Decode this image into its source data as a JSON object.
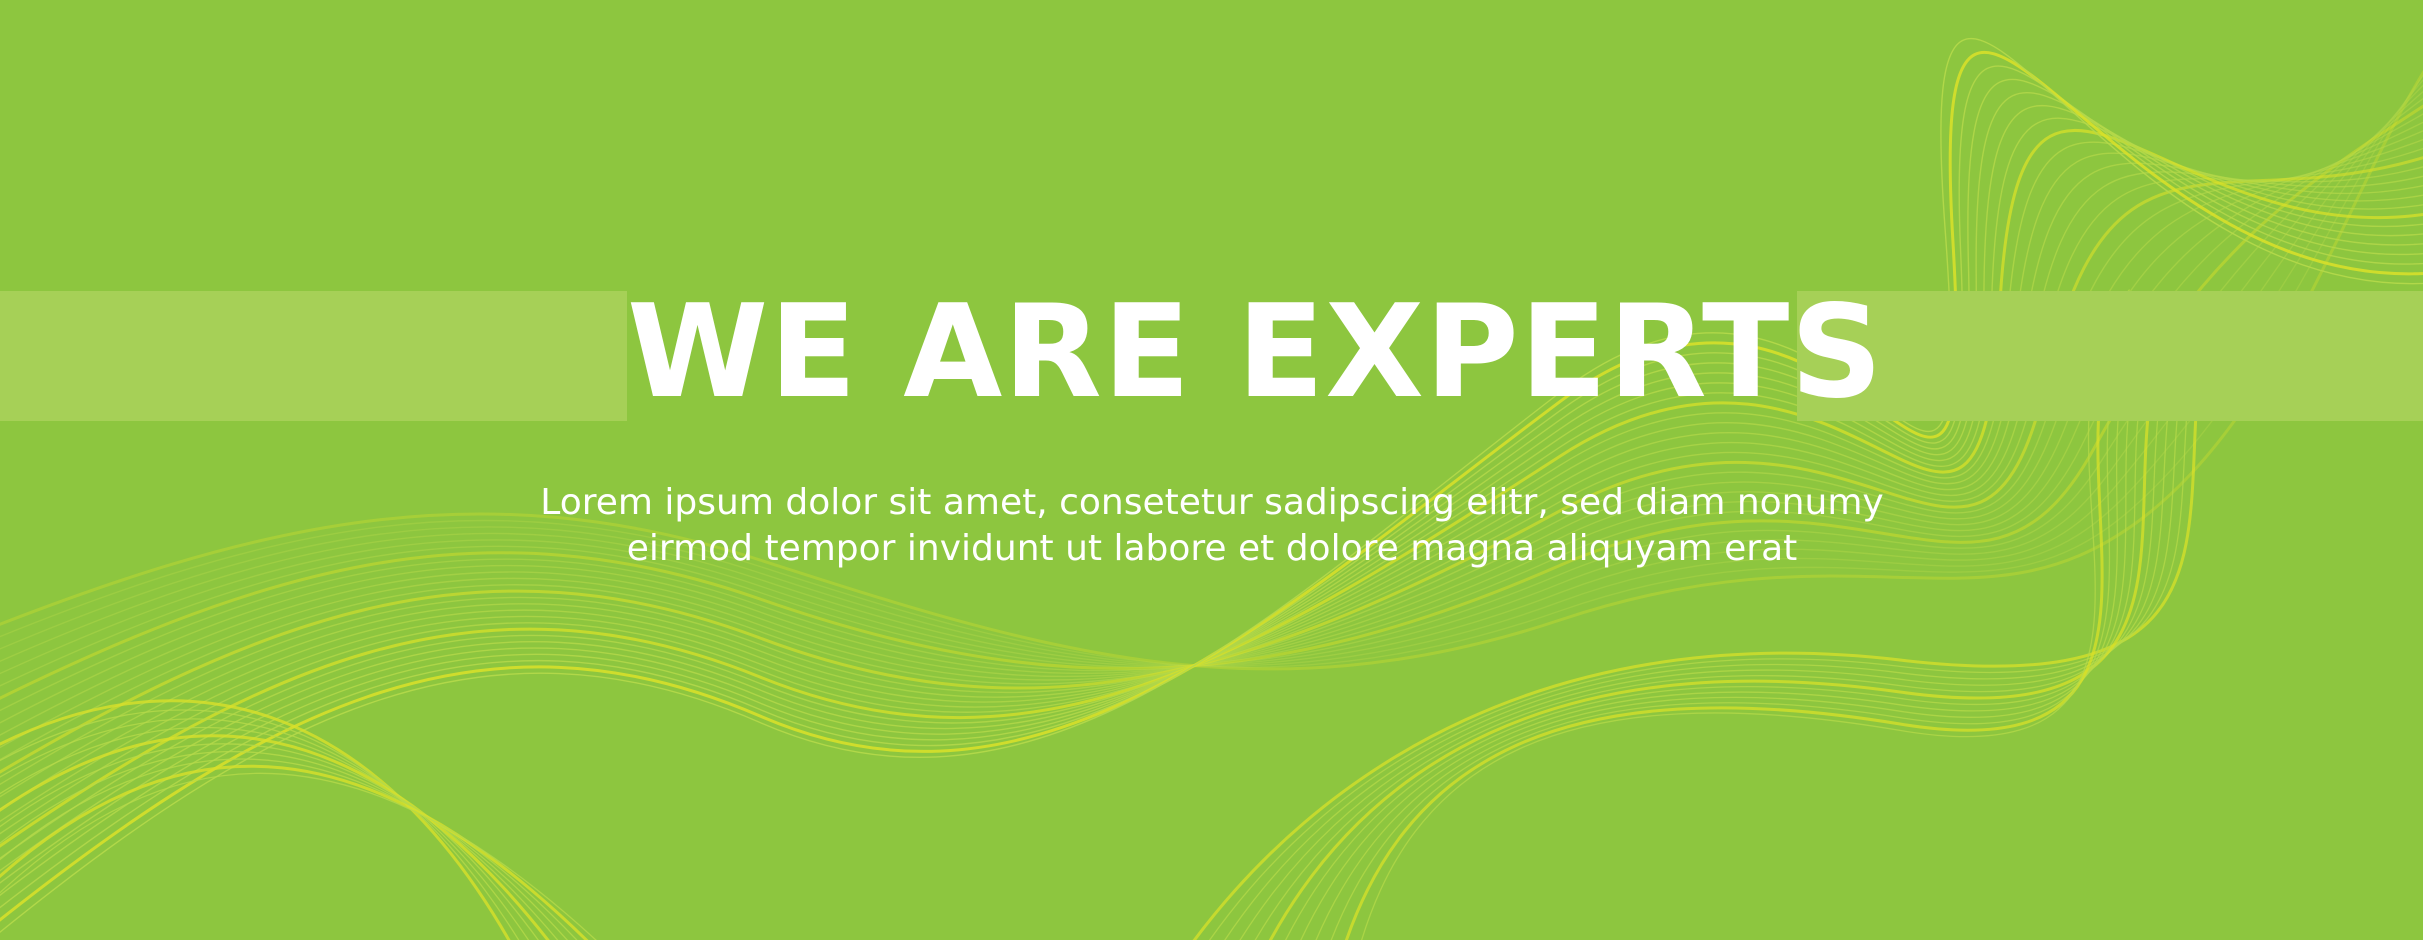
{
  "banner": {
    "headline": "WE ARE EXPERTS",
    "subtitle_line1": "Lorem ipsum dolor sit amet, consetetur sadipscing elitr, sed diam nonumy",
    "subtitle_line2": "eirmod tempor invidunt ut labore et dolore magna aliquyam erat"
  },
  "colors": {
    "background": "#8dc63f",
    "band": "#a6d057",
    "wave_light": "#b5d94a",
    "wave_accent": "#d8e02a",
    "text": "#ffffff"
  }
}
